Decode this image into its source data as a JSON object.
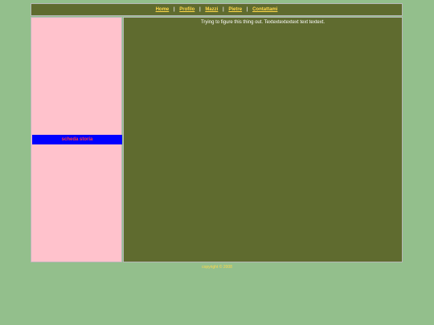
{
  "nav": {
    "items": [
      "Home",
      "Profilo",
      "Mazzi",
      "Pietre",
      "Contattami"
    ],
    "separator": "|"
  },
  "sidebar": {
    "band_text": "scheda storia"
  },
  "main": {
    "text": "Trying to figure this thing out. Textextextextext text textext."
  },
  "footer": {
    "text": "copyright © 2008"
  },
  "colors": {
    "page_bg": "#93bf8c",
    "panel_bg": "#5f6b2f",
    "sidebar_bg": "#ffc2cc",
    "band_bg": "#0000ff",
    "link": "#ffd84a"
  }
}
